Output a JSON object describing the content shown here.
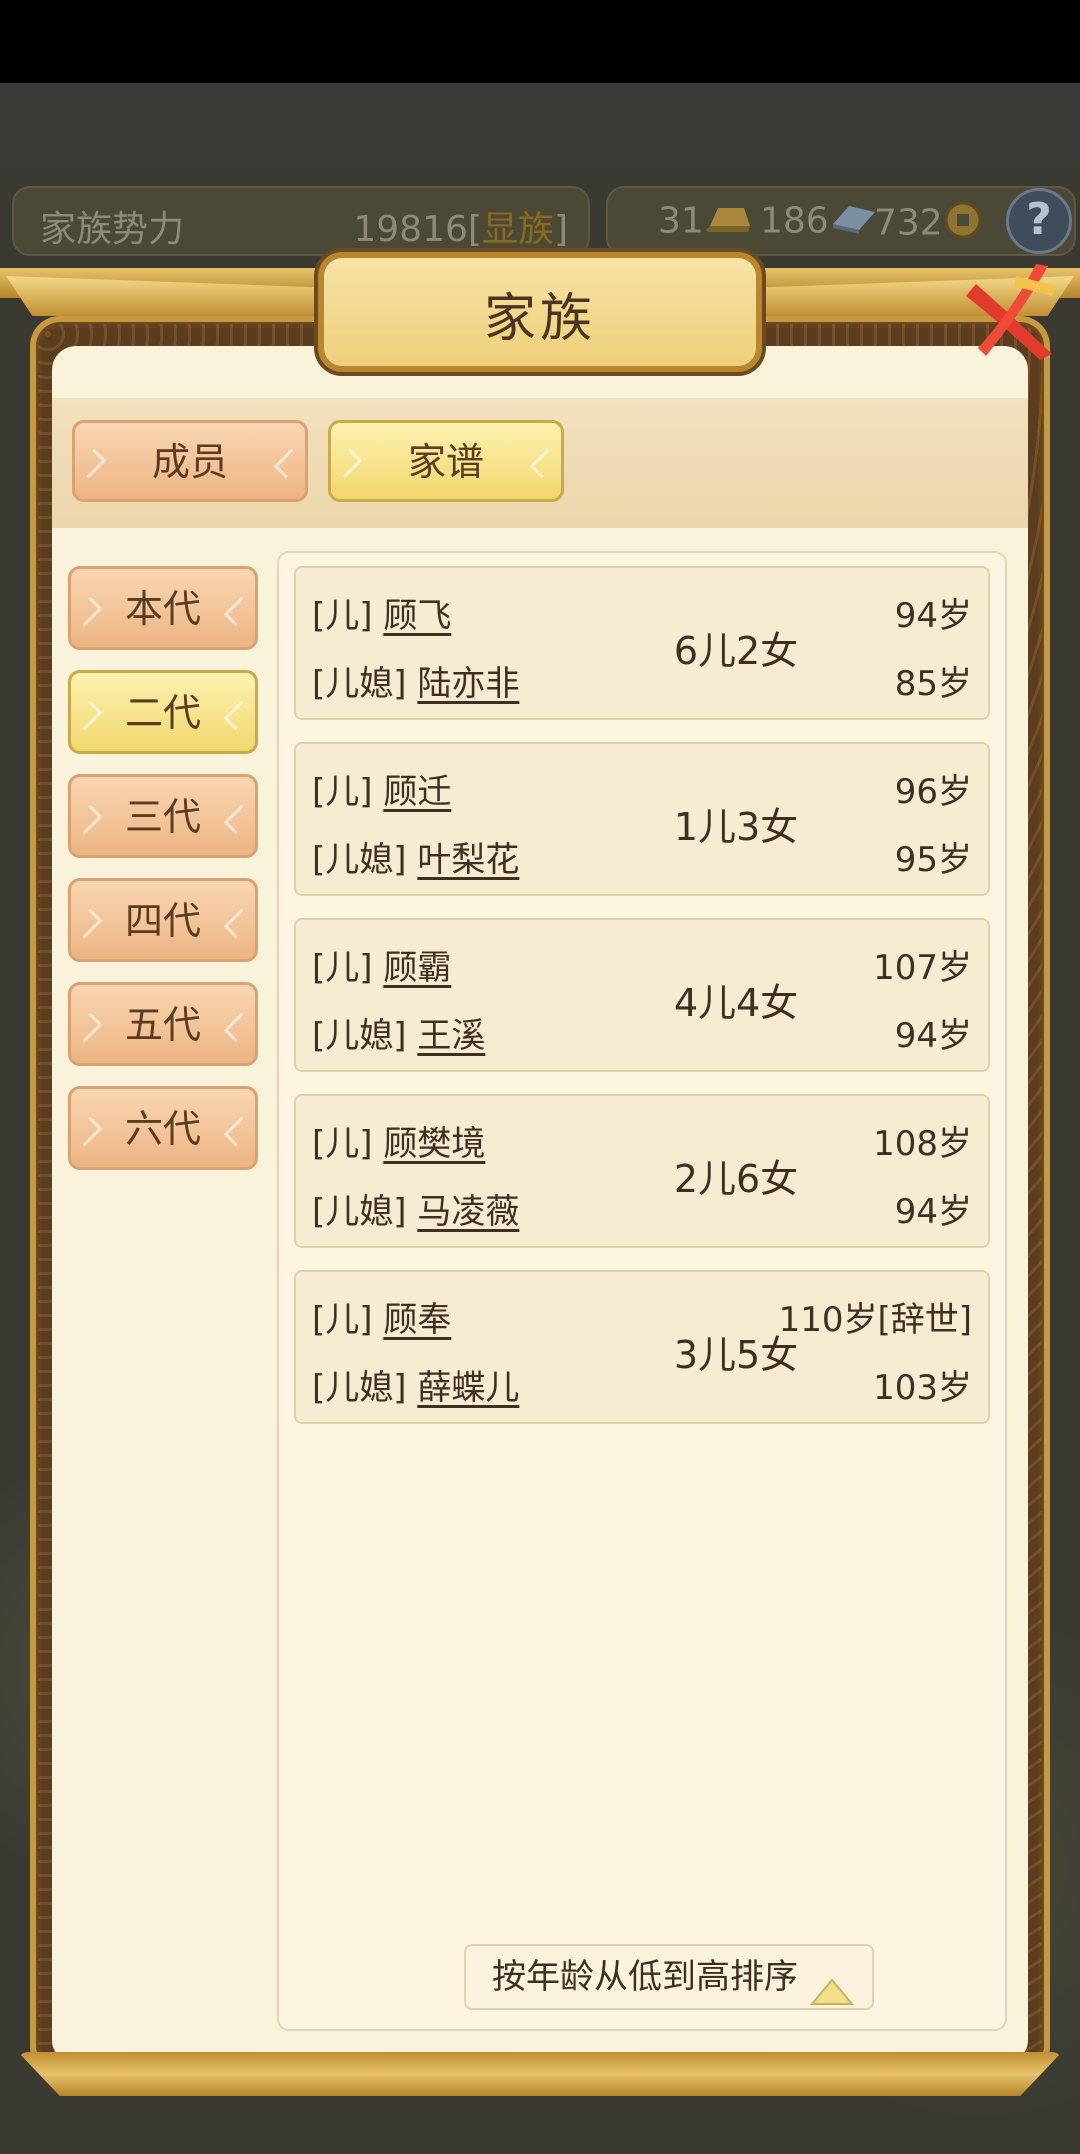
{
  "header": {
    "power_label": "家族势力",
    "power_value": "19816",
    "rank_prefix": "[",
    "rank": "显族",
    "rank_suffix": "]",
    "resources": [
      {
        "value": "31",
        "icon": "gold-ingot-icon"
      },
      {
        "value": "186",
        "icon": "silver-ingot-icon"
      },
      {
        "value": "732",
        "icon": "copper-coin-icon"
      }
    ],
    "help_label": "?"
  },
  "dialog": {
    "title": "家族",
    "tabs": [
      {
        "label": "成员",
        "active": false
      },
      {
        "label": "家谱",
        "active": true
      }
    ],
    "generations": [
      {
        "label": "本代",
        "active": false
      },
      {
        "label": "二代",
        "active": true
      },
      {
        "label": "三代",
        "active": false
      },
      {
        "label": "四代",
        "active": false
      },
      {
        "label": "五代",
        "active": false
      },
      {
        "label": "六代",
        "active": false
      }
    ],
    "members": [
      {
        "role1": "[儿]",
        "name1": "顾飞",
        "role2": "[儿媳]",
        "name2": "陆亦非",
        "children": "6儿2女",
        "age1": "94岁",
        "age2": "85岁"
      },
      {
        "role1": "[儿]",
        "name1": "顾迁",
        "role2": "[儿媳]",
        "name2": "叶梨花",
        "children": "1儿3女",
        "age1": "96岁",
        "age2": "95岁"
      },
      {
        "role1": "[儿]",
        "name1": "顾霸",
        "role2": "[儿媳]",
        "name2": "王溪",
        "children": "4儿4女",
        "age1": "107岁",
        "age2": "94岁"
      },
      {
        "role1": "[儿]",
        "name1": "顾樊境",
        "role2": "[儿媳]",
        "name2": "马凌薇",
        "children": "2儿6女",
        "age1": "108岁",
        "age2": "94岁"
      },
      {
        "role1": "[儿]",
        "name1": "顾奉",
        "role2": "[儿媳]",
        "name2": "薛蝶儿",
        "children": "3儿5女",
        "age1": "110岁[辞世]",
        "age2": "103岁"
      }
    ],
    "sort_label": "按年龄从低到高排序"
  },
  "colors": {
    "panel_bg": "#faf3dc",
    "tab_active": "#f1d76e",
    "tab_inactive": "#edb483",
    "close_red": "#e23b2e",
    "frame_gold": "#c79a3f"
  }
}
